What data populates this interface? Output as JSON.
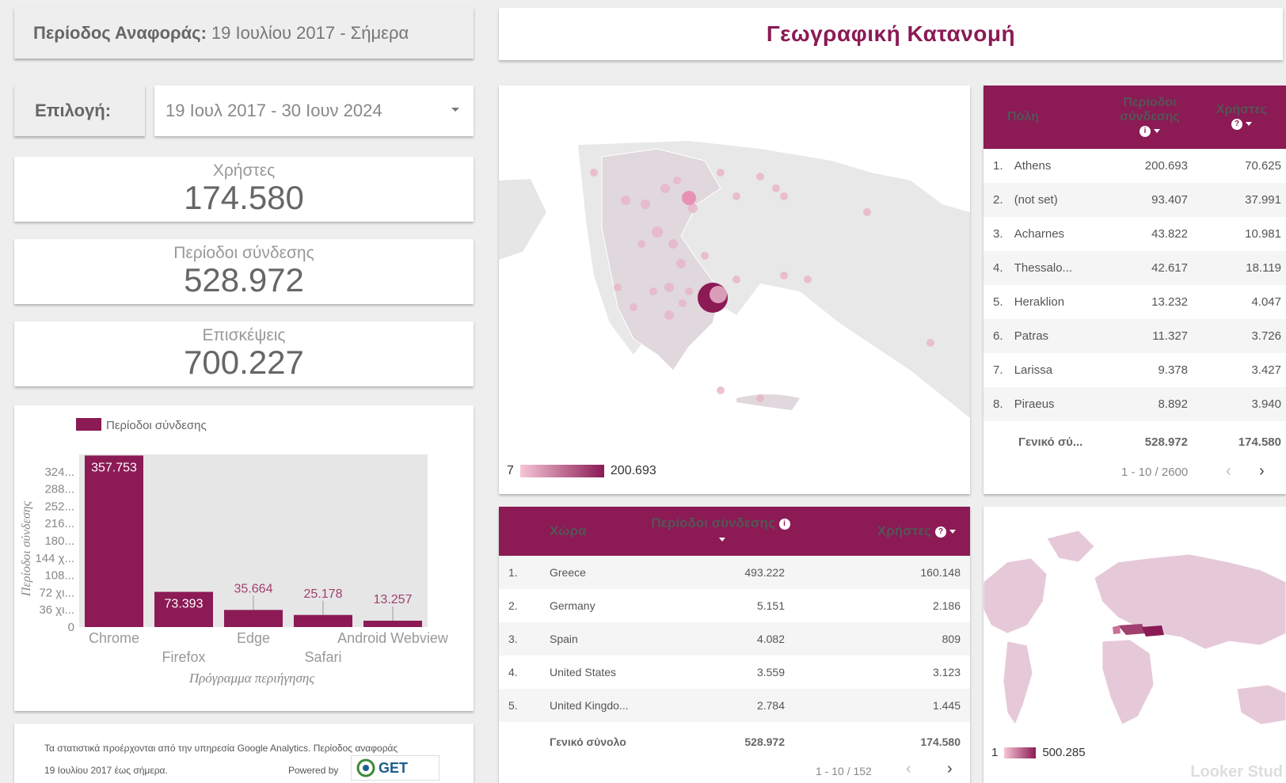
{
  "period": {
    "label": "Περίοδος Αναφοράς:",
    "value": "19 Ιουλίου 2017 - Σήμερα"
  },
  "title": "Γεωγραφική Κατανομή",
  "selector": {
    "label": "Επιλογή:",
    "value": "19 Ιουλ 2017 - 30 Ιουν 2024"
  },
  "kpis": [
    {
      "label": "Χρήστες",
      "value": "174.580"
    },
    {
      "label": "Περίοδοι σύνδεσης",
      "value": "528.972"
    },
    {
      "label": "Επισκέψεις",
      "value": "700.227"
    }
  ],
  "chart_data": {
    "type": "bar",
    "legend": "Περίοδοι σύνδεσης",
    "legend_position": "top-left",
    "categories": [
      "Chrome",
      "Firefox",
      "Edge",
      "Safari",
      "Android Webview"
    ],
    "values": [
      357753,
      73393,
      35664,
      25178,
      13257
    ],
    "value_labels": [
      "357.753",
      "73.393",
      "35.664",
      "25.178",
      "13.257"
    ],
    "ylabel": "Περίοδοι σύνδεσης",
    "xlabel": "Πρόγραμμα περιήγησης",
    "ytick_labels": [
      "0",
      "36 χι...",
      "72 χι...",
      "108...",
      "144 χ...",
      "180...",
      "216...",
      "252...",
      "288...",
      "324..."
    ],
    "yticks": [
      0,
      36000,
      72000,
      108000,
      144000,
      180000,
      216000,
      252000,
      288000,
      324000
    ],
    "ylim": [
      0,
      360000
    ],
    "bar_color": "#8b1a55",
    "grid": false
  },
  "footer": {
    "line1": "Τα στατιστικά προέρχονται από την υπηρεσία Google Analytics. Περίοδος αναφοράς",
    "line2": "19 Ιουλίου 2017 έως σήμερα.",
    "powered": "Powered by",
    "logo": "GET"
  },
  "greece_map": {
    "legend_min": "7",
    "legend_max": "200.693"
  },
  "city_table": {
    "headers": [
      "Πόλη",
      "Περίοδοι σύνδεσης",
      "Χρήστες"
    ],
    "rows": [
      {
        "idx": "1.",
        "city": "Athens",
        "sessions": "200.693",
        "users": "70.625"
      },
      {
        "idx": "2.",
        "city": "(not set)",
        "sessions": "93.407",
        "users": "37.991"
      },
      {
        "idx": "3.",
        "city": "Acharnes",
        "sessions": "43.822",
        "users": "10.981"
      },
      {
        "idx": "4.",
        "city": "Thessalo...",
        "sessions": "42.617",
        "users": "18.119"
      },
      {
        "idx": "5.",
        "city": "Heraklion",
        "sessions": "13.232",
        "users": "4.047"
      },
      {
        "idx": "6.",
        "city": "Patras",
        "sessions": "11.327",
        "users": "3.726"
      },
      {
        "idx": "7.",
        "city": "Larissa",
        "sessions": "9.378",
        "users": "3.427"
      },
      {
        "idx": "8.",
        "city": "Piraeus",
        "sessions": "8.892",
        "users": "3.940"
      }
    ],
    "total": {
      "label": "Γενικό σύ...",
      "sessions": "528.972",
      "users": "174.580"
    },
    "pager": "1 - 10 / 2600"
  },
  "country_table": {
    "headers": [
      "Χώρα",
      "Περίοδοι σύνδεσης",
      "Χρήστες"
    ],
    "rows": [
      {
        "idx": "1.",
        "country": "Greece",
        "sessions": "493.222",
        "users": "160.148"
      },
      {
        "idx": "2.",
        "country": "Germany",
        "sessions": "5.151",
        "users": "2.186"
      },
      {
        "idx": "3.",
        "country": "Spain",
        "sessions": "4.082",
        "users": "809"
      },
      {
        "idx": "4.",
        "country": "United States",
        "sessions": "3.559",
        "users": "3.123"
      },
      {
        "idx": "5.",
        "country": "United Kingdo...",
        "sessions": "2.784",
        "users": "1.445"
      }
    ],
    "total": {
      "label": "Γενικό σύνολο",
      "sessions": "528.972",
      "users": "174.580"
    },
    "pager": "1 - 10 / 152"
  },
  "world_map": {
    "legend_min": "1",
    "legend_max": "500.285",
    "watermark": "Looker Stud"
  }
}
